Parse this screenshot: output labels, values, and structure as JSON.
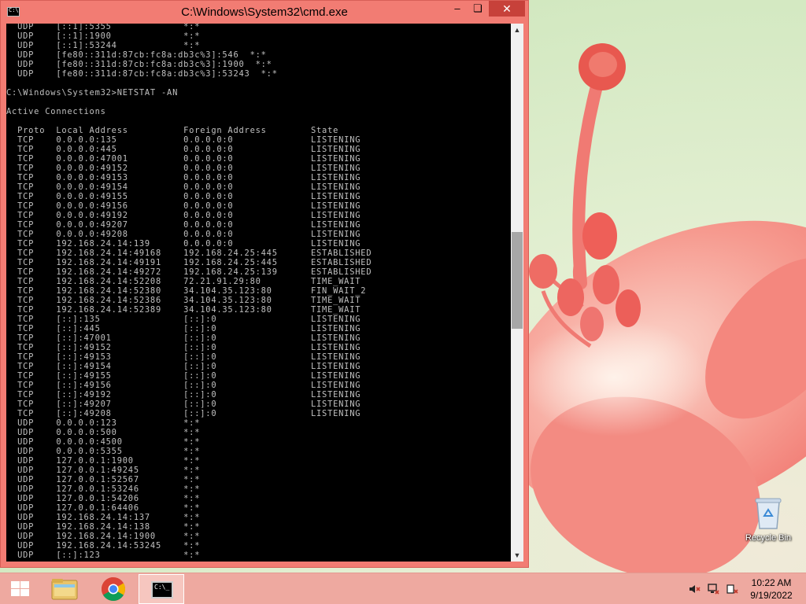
{
  "window": {
    "title": "C:\\Windows\\System32\\cmd.exe",
    "minimize_glyph": "–",
    "maximize_glyph": "❏",
    "close_glyph": "✕"
  },
  "console": {
    "lines": [
      "  UDP    [::1]:5355             *:*",
      "  UDP    [::1]:1900             *:*",
      "  UDP    [::1]:53244            *:*",
      "  UDP    [fe80::311d:87cb:fc8a:db3c%3]:546  *:*",
      "  UDP    [fe80::311d:87cb:fc8a:db3c%3]:1900  *:*",
      "  UDP    [fe80::311d:87cb:fc8a:db3c%3]:53243  *:*",
      "",
      "C:\\Windows\\System32>NETSTAT -AN",
      "",
      "Active Connections",
      "",
      "  Proto  Local Address          Foreign Address        State",
      "  TCP    0.0.0.0:135            0.0.0.0:0              LISTENING",
      "  TCP    0.0.0.0:445            0.0.0.0:0              LISTENING",
      "  TCP    0.0.0.0:47001          0.0.0.0:0              LISTENING",
      "  TCP    0.0.0.0:49152          0.0.0.0:0              LISTENING",
      "  TCP    0.0.0.0:49153          0.0.0.0:0              LISTENING",
      "  TCP    0.0.0.0:49154          0.0.0.0:0              LISTENING",
      "  TCP    0.0.0.0:49155          0.0.0.0:0              LISTENING",
      "  TCP    0.0.0.0:49156          0.0.0.0:0              LISTENING",
      "  TCP    0.0.0.0:49192          0.0.0.0:0              LISTENING",
      "  TCP    0.0.0.0:49207          0.0.0.0:0              LISTENING",
      "  TCP    0.0.0.0:49208          0.0.0.0:0              LISTENING",
      "  TCP    192.168.24.14:139      0.0.0.0:0              LISTENING",
      "  TCP    192.168.24.14:49168    192.168.24.25:445      ESTABLISHED",
      "  TCP    192.168.24.14:49191    192.168.24.25:445      ESTABLISHED",
      "  TCP    192.168.24.14:49272    192.168.24.25:139      ESTABLISHED",
      "  TCP    192.168.24.14:52208    72.21.91.29:80         TIME_WAIT",
      "  TCP    192.168.24.14:52380    34.104.35.123:80       FIN_WAIT_2",
      "  TCP    192.168.24.14:52386    34.104.35.123:80       TIME_WAIT",
      "  TCP    192.168.24.14:52389    34.104.35.123:80       TIME_WAIT",
      "  TCP    [::]:135               [::]:0                 LISTENING",
      "  TCP    [::]:445               [::]:0                 LISTENING",
      "  TCP    [::]:47001             [::]:0                 LISTENING",
      "  TCP    [::]:49152             [::]:0                 LISTENING",
      "  TCP    [::]:49153             [::]:0                 LISTENING",
      "  TCP    [::]:49154             [::]:0                 LISTENING",
      "  TCP    [::]:49155             [::]:0                 LISTENING",
      "  TCP    [::]:49156             [::]:0                 LISTENING",
      "  TCP    [::]:49192             [::]:0                 LISTENING",
      "  TCP    [::]:49207             [::]:0                 LISTENING",
      "  TCP    [::]:49208             [::]:0                 LISTENING",
      "  UDP    0.0.0.0:123            *:*",
      "  UDP    0.0.0.0:500            *:*",
      "  UDP    0.0.0.0:4500           *:*",
      "  UDP    0.0.0.0:5355           *:*",
      "  UDP    127.0.0.1:1900         *:*",
      "  UDP    127.0.0.1:49245        *:*",
      "  UDP    127.0.0.1:52567        *:*",
      "  UDP    127.0.0.1:53246        *:*",
      "  UDP    127.0.0.1:54206        *:*",
      "  UDP    127.0.0.1:64406        *:*",
      "  UDP    192.168.24.14:137      *:*",
      "  UDP    192.168.24.14:138      *:*",
      "  UDP    192.168.24.14:1900     *:*",
      "  UDP    192.168.24.14:53245    *:*",
      "  UDP    [::]:123               *:*"
    ],
    "colors": {
      "background": "#000000",
      "foreground": "#c0c0c0"
    }
  },
  "scrollbar": {
    "up_glyph": "▲",
    "down_glyph": "▼"
  },
  "desktop": {
    "recycle_bin_label": "Recycle Bin",
    "accent_colors": {
      "window_frame": "#f27c73",
      "taskbar": "#eea9a0",
      "flower": "#f26a6a"
    }
  },
  "taskbar": {
    "start_icon": "windows-logo-icon",
    "pinned": [
      {
        "name": "file-explorer",
        "icon": "folder-icon"
      },
      {
        "name": "chrome",
        "icon": "chrome-icon"
      },
      {
        "name": "command-prompt",
        "icon": "cmd-icon",
        "label": "C:\\_",
        "active": true
      }
    ],
    "tray_icons": [
      "speaker-muted-icon",
      "network-icon",
      "action-center-icon"
    ],
    "clock": {
      "time": "10:22 AM",
      "date": "9/19/2022"
    }
  }
}
